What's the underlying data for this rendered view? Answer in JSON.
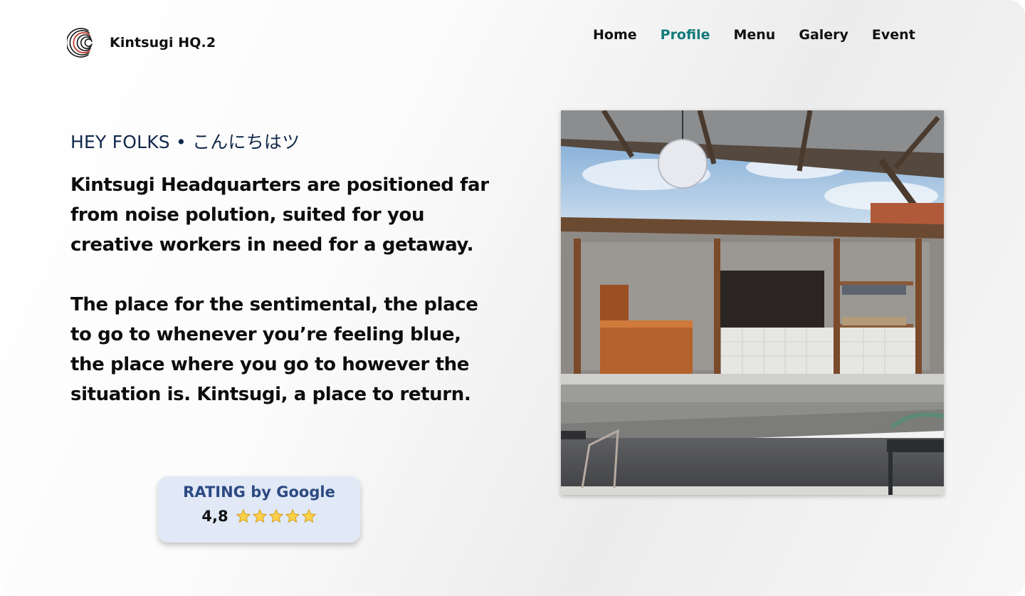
{
  "brand": {
    "name": "Kintsugi HQ.2",
    "logo_icon": "kintsugi-logo-icon"
  },
  "nav": {
    "items": [
      {
        "label": "Home",
        "active": false
      },
      {
        "label": "Profile",
        "active": true
      },
      {
        "label": "Menu",
        "active": false
      },
      {
        "label": "Galery",
        "active": false
      },
      {
        "label": "Event",
        "active": false
      }
    ],
    "active_color": "#127a7b"
  },
  "hero": {
    "eyebrow": "HEY FOLKS • こんにちはツ",
    "paragraph_1": "Kintsugi Headquarters are positioned far from noise polution, suited for you creative workers in need for a getaway.",
    "paragraph_2": "The place for the sentimental, the place to go to whenever you’re feeling blue, the place where you go to however the situation is. Kintsugi, a place to return."
  },
  "rating": {
    "title": "RATING by Google",
    "value": "4,8",
    "stars": 5,
    "star_icon": "star-icon"
  },
  "photo": {
    "subject": "cafe-building-photo"
  }
}
